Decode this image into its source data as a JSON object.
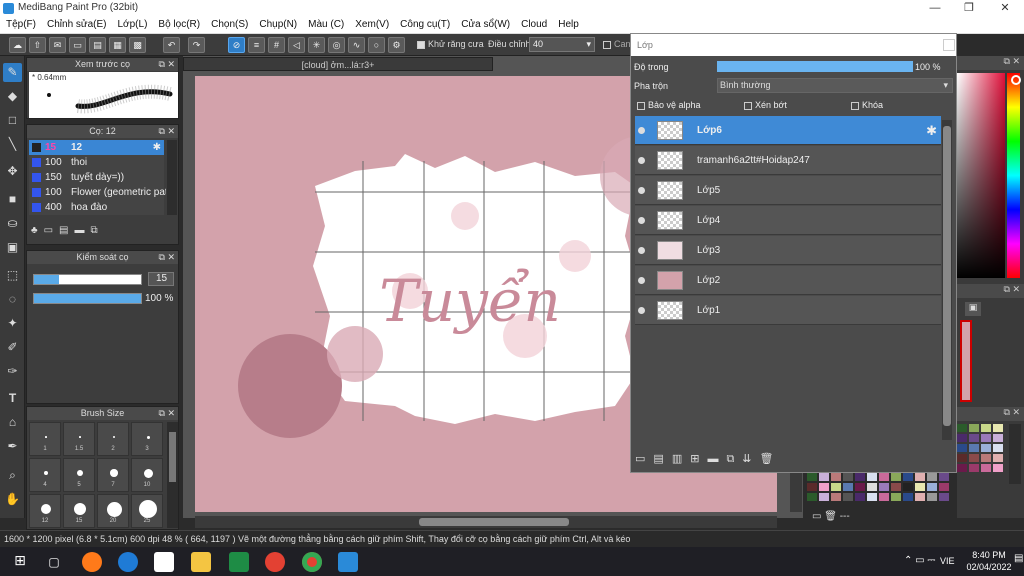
{
  "app": {
    "title": "MediBang Paint Pro (32bit)"
  },
  "window_controls": {
    "minimize": "—",
    "maximize": "❐",
    "close": "✕"
  },
  "menu": [
    "Tệp(F)",
    "Chỉnh sửa(E)",
    "Lớp(L)",
    "Bộ lọc(R)",
    "Chọn(S)",
    "Chụp(N)",
    "Màu (C)",
    "Xem(V)",
    "Công cụ(T)",
    "Cửa sổ(W)",
    "Cloud",
    "Help"
  ],
  "toolbar": {
    "antialias_label": "Khử răng cưa",
    "correction_label": "Điều chỉnh",
    "correction_value": "40",
    "canvas_label": "Can"
  },
  "brush_preview": {
    "title": "Xem trước cọ",
    "size_label": "* 0.64mm"
  },
  "brush_list": {
    "title": "Cọ: 12",
    "items": [
      {
        "size": "15",
        "name": "12",
        "selected": true
      },
      {
        "size": "100",
        "name": "thoi"
      },
      {
        "size": "150",
        "name": "tuyết dày=))"
      },
      {
        "size": "100",
        "name": "Flower (geometric patt"
      },
      {
        "size": "400",
        "name": "hoa đào"
      }
    ]
  },
  "brush_control": {
    "title": "Kiểm soát cọ",
    "size_value": "15",
    "opacity_value": "100 %",
    "size_fraction": 0.23,
    "opacity_fraction": 1.0
  },
  "brush_size": {
    "title": "Brush Size",
    "labels": [
      [
        "1",
        "1.5",
        "2",
        "3"
      ],
      [
        "4",
        "5",
        "7",
        "10"
      ],
      [
        "12",
        "15",
        "20",
        "25"
      ]
    ]
  },
  "canvas": {
    "tab_title": "[cloud] ởm...lá:r3+",
    "art_text": "Tuyển",
    "colors": {
      "background": "#d3a2ab",
      "paper": "#ffffff",
      "ink": "#c98a99"
    }
  },
  "layer_panel": {
    "title": "Lớp",
    "opacity_label": "Độ trong",
    "opacity_value": "100 %",
    "blend_label": "Pha trộn",
    "blend_value": "Bình thường",
    "protect_alpha": "Bảo vệ alpha",
    "clipping": "Xén bớt",
    "lock": "Khóa",
    "layers": [
      {
        "name": "Lớp6",
        "selected": true
      },
      {
        "name": "tramanh6a2tt#Hoidap247"
      },
      {
        "name": "Lớp5"
      },
      {
        "name": "Lớp4"
      },
      {
        "name": "Lớp3"
      },
      {
        "name": "Lớp2"
      },
      {
        "name": "Lớp1"
      }
    ]
  },
  "status": {
    "text": "1600 * 1200 pixel  (6.8 * 5.1cm)  600 dpi  48 %  ( 664, 1197 )  Vẽ một đường thẳng bằng cách giữ phím Shift, Thay đổi cỡ cọ bằng cách giữ phím Ctrl, Alt và kéo"
  },
  "taskbar": {
    "time": "8:40 PM",
    "date": "02/04/2022",
    "lang": "VIE"
  },
  "palette_footer": "---"
}
